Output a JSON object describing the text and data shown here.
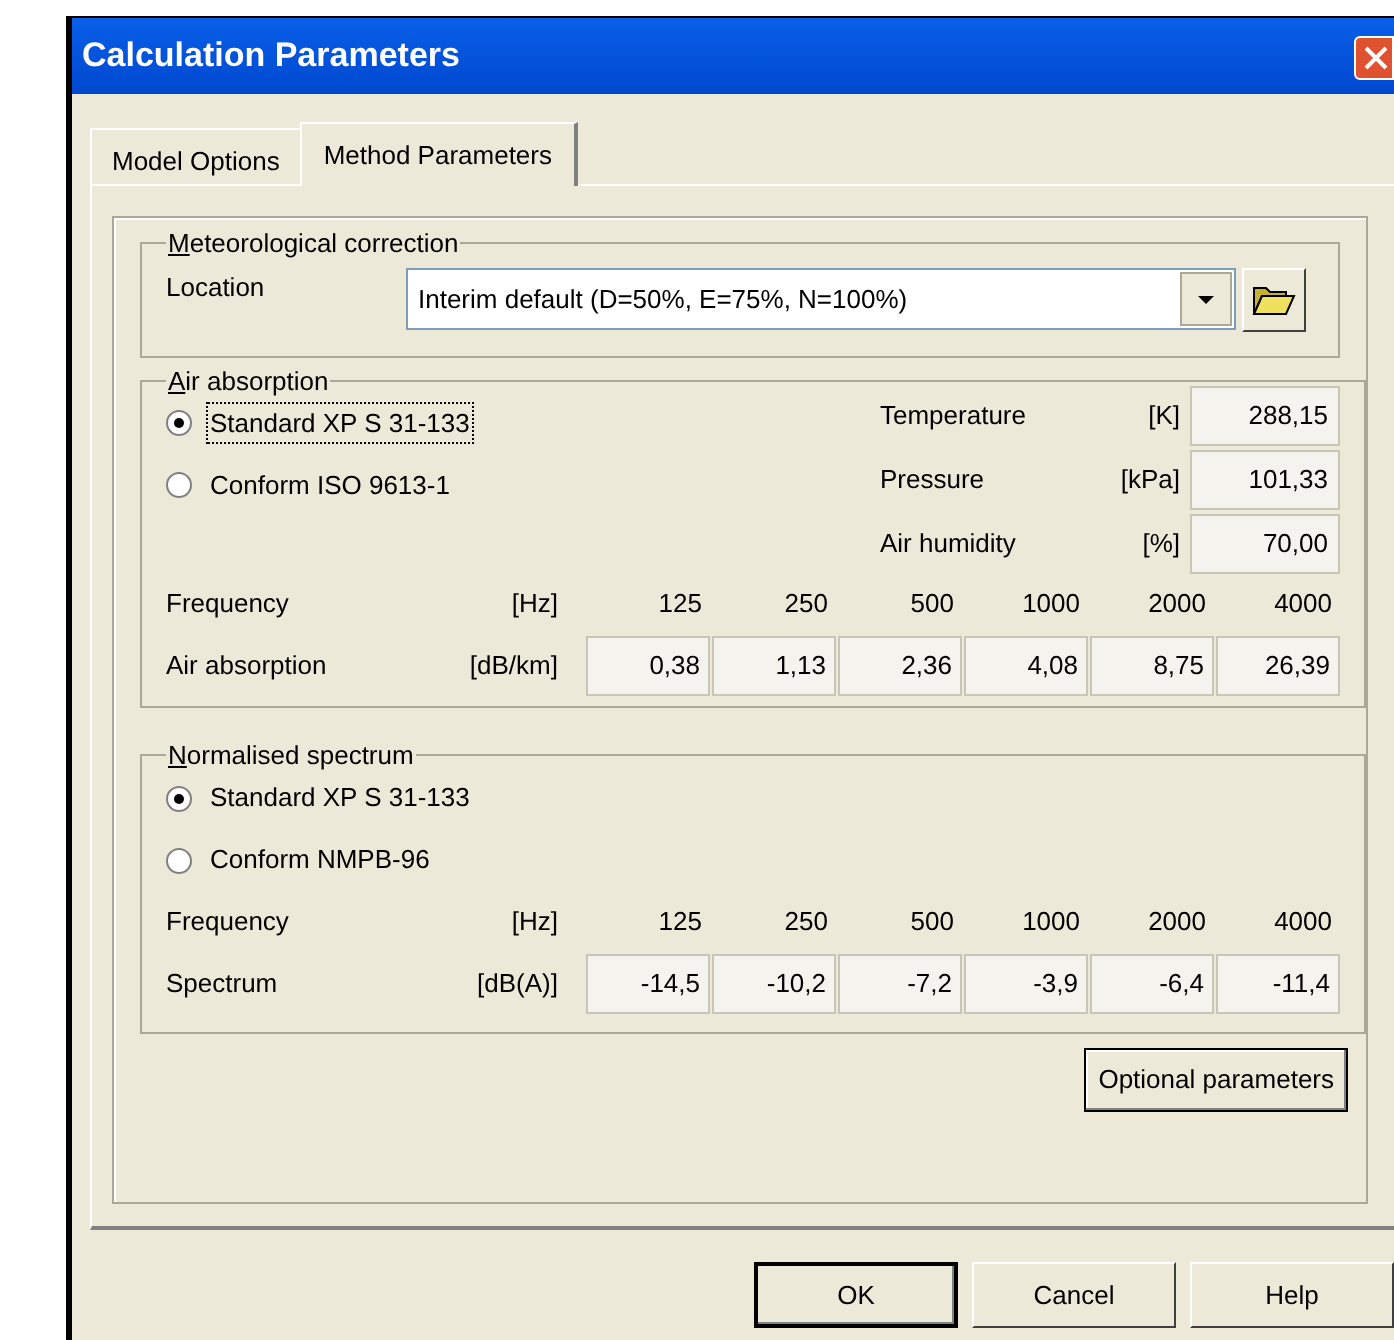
{
  "window": {
    "title": "Calculation Parameters"
  },
  "tabs": [
    {
      "label": "Model Options",
      "selected": false
    },
    {
      "label": "Method Parameters",
      "selected": true
    }
  ],
  "meteorological": {
    "title": "Meteorological  correction",
    "location_label": "Location",
    "location_value": "Interim default (D=50%, E=75%, N=100%)"
  },
  "air_absorption": {
    "title": "Air absorption",
    "options": [
      {
        "label": "Standard XP S 31-133",
        "selected": true,
        "focused": true
      },
      {
        "label": "Conform ISO 9613-1",
        "selected": false,
        "focused": false
      }
    ],
    "params": [
      {
        "label": "Temperature",
        "unit": "[K]",
        "value": "288,15"
      },
      {
        "label": "Pressure",
        "unit": "[kPa]",
        "value": "101,33"
      },
      {
        "label": "Air humidity",
        "unit": "[%]",
        "value": "70,00"
      }
    ],
    "frequency_label": "Frequency",
    "frequency_unit": "[Hz]",
    "frequencies": [
      "125",
      "250",
      "500",
      "1000",
      "2000",
      "4000"
    ],
    "row_label": "Air absorption",
    "row_unit": "[dB/km]",
    "values": [
      "0,38",
      "1,13",
      "2,36",
      "4,08",
      "8,75",
      "26,39"
    ]
  },
  "normalised_spectrum": {
    "title": "Normalised spectrum",
    "options": [
      {
        "label": "Standard XP S 31-133",
        "selected": true,
        "focused": false
      },
      {
        "label": "Conform NMPB-96",
        "selected": false,
        "focused": false
      }
    ],
    "frequency_label": "Frequency",
    "frequency_unit": "[Hz]",
    "frequencies": [
      "125",
      "250",
      "500",
      "1000",
      "2000",
      "4000"
    ],
    "row_label": "Spectrum",
    "row_unit": "[dB(A)]",
    "values": [
      "-14,5",
      "-10,2",
      "-7,2",
      "-3,9",
      "-6,4",
      "-11,4"
    ]
  },
  "optional_button": "Optional parameters",
  "buttons": [
    {
      "label": "OK",
      "default": true
    },
    {
      "label": "Cancel",
      "default": false
    },
    {
      "label": "Help",
      "default": false
    }
  ]
}
